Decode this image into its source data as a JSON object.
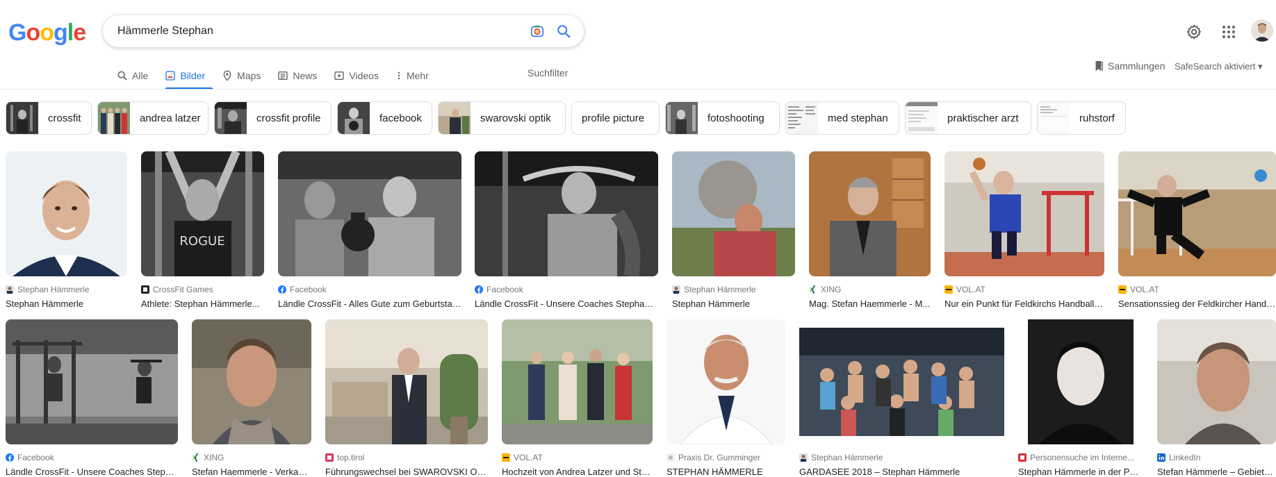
{
  "logo": {
    "text": "Google",
    "colors": [
      "#4285f4",
      "#ea4335",
      "#fbbc05",
      "#4285f4",
      "#34a853",
      "#ea4335"
    ]
  },
  "search": {
    "query": "Hämmerle Stephan"
  },
  "tabs": [
    {
      "label": "Alle",
      "icon": "search-icon",
      "active": false
    },
    {
      "label": "Bilder",
      "icon": "image-icon",
      "active": true
    },
    {
      "label": "Maps",
      "icon": "map-pin-icon",
      "active": false
    },
    {
      "label": "News",
      "icon": "news-icon",
      "active": false
    },
    {
      "label": "Videos",
      "icon": "video-icon",
      "active": false
    },
    {
      "label": "Mehr",
      "icon": "more-vert-icon",
      "active": false
    }
  ],
  "tools_label": "Suchfilter",
  "collections_label": "Sammlungen",
  "safesearch_label": "SafeSearch aktiviert",
  "chips": [
    {
      "label": "crossfit"
    },
    {
      "label": "andrea latzer"
    },
    {
      "label": "crossfit profile"
    },
    {
      "label": "facebook"
    },
    {
      "label": "swarovski optik"
    },
    {
      "label": "profile picture"
    },
    {
      "label": "fotoshooting"
    },
    {
      "label": "med stephan"
    },
    {
      "label": "praktischer arzt"
    },
    {
      "label": "ruhstorf"
    }
  ],
  "results": [
    {
      "source": "Stephan Hämmerle",
      "title": "Stephan Hämmerle",
      "favicon": "person-icon"
    },
    {
      "source": "CrossFit Games",
      "title": "Athlete: Stephan Hämmerle...",
      "favicon": "crossfit-icon"
    },
    {
      "source": "Facebook",
      "title": "Ländle CrossFit - Alles Gute zum Geburtstag ...",
      "favicon": "facebook-icon"
    },
    {
      "source": "Facebook",
      "title": "Ländle CrossFit - Unsere Coaches Stephan H...",
      "favicon": "facebook-icon"
    },
    {
      "source": "Stephan Hämmerle",
      "title": "Stephan Hämmerle",
      "favicon": "person-icon"
    },
    {
      "source": "XING",
      "title": "Mag. Stefan Haemmerle - M...",
      "favicon": "xing-icon"
    },
    {
      "source": "VOL.AT",
      "title": "Nur ein Punkt für Feldkirchs Handballe...",
      "favicon": "vol-icon"
    },
    {
      "source": "VOL.AT",
      "title": "Sensationssieg der Feldkircher Handba...",
      "favicon": "vol-icon"
    },
    {
      "source": "Facebook",
      "title": "Ländle CrossFit - Unsere Coaches Stepha...",
      "favicon": "facebook-icon"
    },
    {
      "source": "XING",
      "title": "Stefan Haemmerle - Verkauf...",
      "favicon": "xing-icon"
    },
    {
      "source": "top.tirol",
      "title": "Führungswechsel bei SWAROVSKI OPTIK",
      "favicon": "toptirol-icon"
    },
    {
      "source": "VOL.AT",
      "title": "Hochzeit von Andrea Latzer und Ste...",
      "favicon": "vol-icon"
    },
    {
      "source": "Praxis Dr. Gumminger",
      "title": "STEPHAN HÄMMERLE",
      "favicon": "praxis-icon"
    },
    {
      "source": "Stephan Hämmerle",
      "title": "GARDASEE 2018 – Stephan Hämmerle",
      "favicon": "person-icon"
    },
    {
      "source": "Personensuche im Interne...",
      "title": "Stephan Hämmerle in der Pers...",
      "favicon": "personensuche-icon"
    },
    {
      "source": "LinkedIn",
      "title": "Stefan Hämmerle – Gebietsv...",
      "favicon": "linkedin-icon"
    }
  ]
}
